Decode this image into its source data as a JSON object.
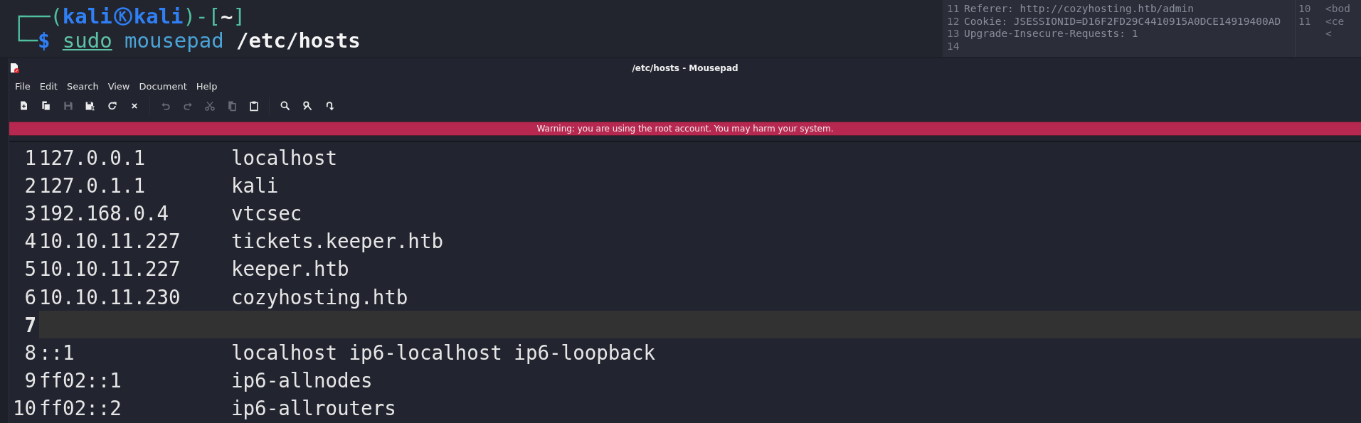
{
  "terminal": {
    "frame_top": "┌──(",
    "user": "kali",
    "host": "kali",
    "frame_mid": ")-[",
    "cwd": "~",
    "frame_end": "]",
    "frame_bottom": "└─",
    "prompt": "$",
    "command": "sudo",
    "argument": "mousepad",
    "path": "/etc/hosts"
  },
  "background_editor": {
    "lines": [
      {
        "number": "11",
        "text": "Referer: http://cozyhosting.htb/admin"
      },
      {
        "number": "12",
        "text": "Cookie: JSESSIONID=D16F2FD29C4410915A0DCE14919400AD"
      },
      {
        "number": "13",
        "text": "Upgrade-Insecure-Requests: 1"
      },
      {
        "number": "14"
      }
    ],
    "side_lines": [
      {
        "number": "10",
        "text": "<bod"
      },
      {
        "number": "11",
        "text": "<ce"
      },
      {
        "text": "<"
      }
    ]
  },
  "window": {
    "title": "/etc/hosts - Mousepad"
  },
  "menu": [
    "File",
    "Edit",
    "Search",
    "View",
    "Document",
    "Help"
  ],
  "toolbar": [
    {
      "kind": "new",
      "disabled": false
    },
    {
      "kind": "new-window",
      "disabled": false
    },
    {
      "kind": "save",
      "disabled": true
    },
    {
      "kind": "save-as",
      "disabled": false
    },
    {
      "kind": "reload",
      "disabled": false
    },
    {
      "kind": "close",
      "disabled": false
    },
    {
      "kind": "separator"
    },
    {
      "kind": "undo",
      "disabled": true
    },
    {
      "kind": "redo",
      "disabled": true
    },
    {
      "kind": "cut",
      "disabled": true
    },
    {
      "kind": "copy",
      "disabled": true
    },
    {
      "kind": "paste",
      "disabled": false
    },
    {
      "kind": "separator"
    },
    {
      "kind": "find",
      "disabled": false
    },
    {
      "kind": "replace",
      "disabled": false
    },
    {
      "kind": "goto",
      "disabled": false
    }
  ],
  "warning": "Warning: you are using the root account. You may harm your system.",
  "editor": {
    "lines": [
      {
        "number": "1",
        "address": "127.0.0.1",
        "names": "localhost",
        "current": false
      },
      {
        "number": "2",
        "address": "127.0.1.1",
        "names": "kali",
        "current": false
      },
      {
        "number": "3",
        "address": "192.168.0.4",
        "names": "vtcsec",
        "current": false
      },
      {
        "number": "4",
        "address": "10.10.11.227",
        "names": "tickets.keeper.htb",
        "current": false
      },
      {
        "number": "5",
        "address": "10.10.11.227",
        "names": "keeper.htb",
        "current": false
      },
      {
        "number": "6",
        "address": "10.10.11.230",
        "names": "cozyhosting.htb",
        "current": false
      },
      {
        "number": "7",
        "current": true
      },
      {
        "number": "8",
        "address": "::1",
        "names": "localhost ip6-localhost ip6-loopback",
        "current": false
      },
      {
        "number": "9",
        "address": "ff02::1",
        "names": "ip6-allnodes",
        "current": false
      },
      {
        "number": "10",
        "address": "ff02::2",
        "names": "ip6-allrouters",
        "current": false
      }
    ]
  }
}
